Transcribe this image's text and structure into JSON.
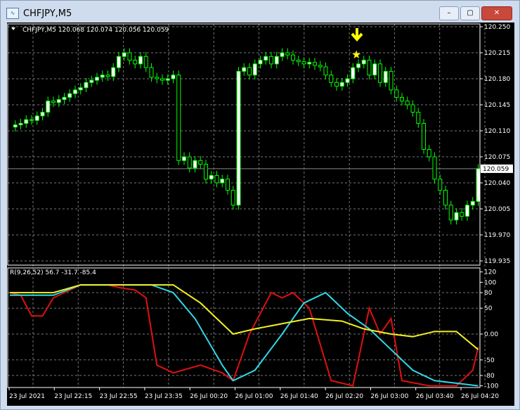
{
  "window": {
    "title": "CHFJPY,M5",
    "minimize": "–",
    "maximize": "▢",
    "close": "✕"
  },
  "chart": {
    "header": "CHFJPY,M5  120.068 120.074 120.056 120.059",
    "current_price": "120.059",
    "price_labels": [
      "120.250",
      "120.215",
      "120.180",
      "120.145",
      "120.110",
      "120.075",
      "120.040",
      "120.005",
      "119.970",
      "119.935"
    ],
    "indicator_header": "R(9,26,52) 56.7 -31.7 -85.4",
    "indicator_labels": [
      "120",
      "100",
      "80",
      "50",
      "0.00",
      "-50",
      "-80",
      "-100"
    ],
    "time_labels": [
      "23 Jul 2021",
      "23 Jul 22:15",
      "23 Jul 22:55",
      "23 Jul 23:35",
      "26 Jul 00:20",
      "26 Jul 01:00",
      "26 Jul 01:40",
      "26 Jul 02:20",
      "26 Jul 03:00",
      "26 Jul 03:40",
      "26 Jul 04:20"
    ],
    "colors": {
      "bull": "#ffffff",
      "bear": "#000000",
      "wick": "#00ff00",
      "red": "#e01010",
      "cyan": "#30d8e8",
      "yellow": "#f0f020",
      "arrow": "#ffff00"
    }
  },
  "chart_data": {
    "type": "candlestick",
    "closes": [
      120.115,
      120.118,
      120.12,
      120.125,
      120.124,
      120.13,
      120.135,
      120.15,
      120.148,
      120.152,
      120.155,
      120.16,
      120.165,
      120.168,
      120.175,
      120.178,
      120.182,
      120.185,
      120.183,
      120.195,
      120.21,
      120.215,
      120.205,
      120.2,
      120.21,
      120.195,
      120.182,
      120.18,
      120.178,
      120.18,
      120.185,
      120.07,
      120.075,
      120.06,
      120.07,
      120.065,
      120.045,
      120.05,
      120.04,
      120.045,
      120.03,
      120.01,
      120.19,
      120.195,
      120.185,
      120.2,
      120.205,
      120.21,
      120.2,
      120.21,
      120.215,
      120.212,
      120.205,
      120.203,
      120.2,
      120.202,
      120.198,
      120.196,
      120.185,
      120.175,
      120.17,
      120.175,
      120.18,
      120.195,
      120.2,
      120.205,
      120.185,
      120.2,
      120.175,
      120.19,
      120.165,
      120.155,
      120.15,
      120.145,
      120.135,
      120.12,
      120.085,
      120.075,
      120.045,
      120.03,
      120.01,
      119.99,
      120.0,
      119.995,
      120.01,
      120.015,
      120.059
    ],
    "indicator": {
      "x_range": [
        0,
        86
      ],
      "y_range": [
        -100,
        120
      ],
      "red": [
        [
          0,
          80
        ],
        [
          2,
          75
        ],
        [
          4,
          35
        ],
        [
          6,
          35
        ],
        [
          8,
          70
        ],
        [
          10,
          80
        ],
        [
          13,
          95
        ],
        [
          18,
          95
        ],
        [
          20,
          90
        ],
        [
          23,
          85
        ],
        [
          25,
          70
        ],
        [
          27,
          -60
        ],
        [
          30,
          -75
        ],
        [
          35,
          -60
        ],
        [
          39,
          -75
        ],
        [
          41,
          -90
        ],
        [
          44,
          0
        ],
        [
          48,
          80
        ],
        [
          50,
          70
        ],
        [
          52,
          80
        ],
        [
          55,
          50
        ],
        [
          59,
          -90
        ],
        [
          63,
          -100
        ],
        [
          66,
          50
        ],
        [
          68,
          0
        ],
        [
          70,
          30
        ],
        [
          72,
          -90
        ],
        [
          77,
          -100
        ],
        [
          82,
          -100
        ],
        [
          85,
          -70
        ],
        [
          86,
          -25
        ]
      ],
      "cyan": [
        [
          0,
          75
        ],
        [
          8,
          75
        ],
        [
          13,
          95
        ],
        [
          26,
          95
        ],
        [
          30,
          80
        ],
        [
          34,
          30
        ],
        [
          39,
          -60
        ],
        [
          41,
          -90
        ],
        [
          45,
          -70
        ],
        [
          50,
          0
        ],
        [
          54,
          60
        ],
        [
          58,
          80
        ],
        [
          62,
          40
        ],
        [
          66,
          10
        ],
        [
          70,
          -30
        ],
        [
          74,
          -70
        ],
        [
          78,
          -90
        ],
        [
          82,
          -95
        ],
        [
          86,
          -100
        ]
      ],
      "yellow": [
        [
          0,
          80
        ],
        [
          8,
          80
        ],
        [
          13,
          95
        ],
        [
          30,
          95
        ],
        [
          35,
          60
        ],
        [
          41,
          0
        ],
        [
          45,
          10
        ],
        [
          50,
          20
        ],
        [
          55,
          30
        ],
        [
          61,
          25
        ],
        [
          65,
          10
        ],
        [
          70,
          0
        ],
        [
          74,
          -5
        ],
        [
          78,
          5
        ],
        [
          82,
          5
        ],
        [
          86,
          -30
        ]
      ]
    }
  }
}
